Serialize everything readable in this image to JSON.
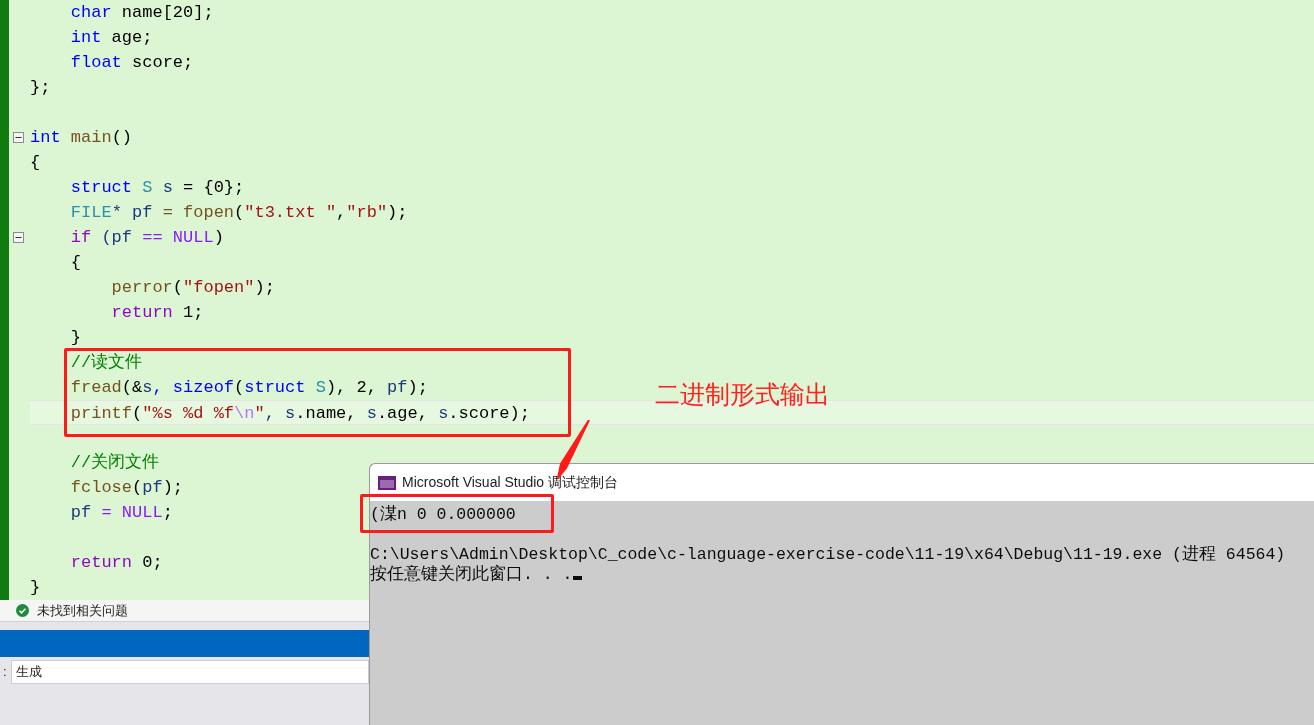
{
  "editor": {
    "lines": [
      {
        "fold_marker": false,
        "current": false,
        "tokens": [
          {
            "t": "    char",
            "kind": "keyword"
          },
          {
            "t": " name[20];",
            "kind": "plain"
          }
        ]
      },
      {
        "fold_marker": false,
        "current": false,
        "tokens": [
          {
            "t": "    int",
            "kind": "keyword"
          },
          {
            "t": " age;",
            "kind": "plain"
          }
        ]
      },
      {
        "fold_marker": false,
        "current": false,
        "tokens": [
          {
            "t": "    float",
            "kind": "keyword"
          },
          {
            "t": " score;",
            "kind": "plain"
          }
        ]
      },
      {
        "fold_marker": false,
        "current": false,
        "tokens": [
          {
            "t": "};",
            "kind": "plain"
          }
        ]
      },
      {
        "fold_marker": false,
        "current": false
      },
      {
        "fold_marker": true,
        "current": false,
        "tokens": [
          {
            "t": "int",
            "kind": "keyword"
          },
          {
            "t": " main",
            "kind": "function"
          },
          {
            "t": "()",
            "kind": "plain"
          }
        ]
      },
      {
        "fold_marker": false,
        "current": false,
        "tokens": [
          {
            "t": "{",
            "kind": "plain"
          }
        ]
      },
      {
        "fold_marker": false,
        "current": false,
        "tokens": [
          {
            "t": "    struct",
            "kind": "keyword"
          },
          {
            "t": " S",
            "kind": "type"
          },
          {
            "t": " s",
            "kind": "local"
          },
          {
            "t": " = {0};",
            "kind": "plain"
          }
        ]
      },
      {
        "fold_marker": false,
        "current": false,
        "tokens": [
          {
            "t": "    FILE",
            "kind": "type"
          },
          {
            "t": "* pf",
            "kind": "local"
          },
          {
            "t": " = fopen",
            "kind": "function"
          },
          {
            "t": "(",
            "kind": "plain"
          },
          {
            "t": "\"t3.txt \"",
            "kind": "string"
          },
          {
            "t": ",",
            "kind": "plain"
          },
          {
            "t": "\"rb\"",
            "kind": "string"
          },
          {
            "t": ");",
            "kind": "plain"
          }
        ]
      },
      {
        "fold_marker": true,
        "current": false,
        "tokens": [
          {
            "t": "    if",
            "kind": "control"
          },
          {
            "t": " (pf",
            "kind": "local"
          },
          {
            "t": " == NULL",
            "kind": "macro"
          },
          {
            "t": ")",
            "kind": "plain"
          }
        ]
      },
      {
        "fold_marker": false,
        "current": false,
        "tokens": [
          {
            "t": "    {",
            "kind": "plain"
          }
        ]
      },
      {
        "fold_marker": false,
        "current": false,
        "tokens": [
          {
            "t": "        perror",
            "kind": "function"
          },
          {
            "t": "(",
            "kind": "plain"
          },
          {
            "t": "\"fopen\"",
            "kind": "string"
          },
          {
            "t": ");",
            "kind": "plain"
          }
        ]
      },
      {
        "fold_marker": false,
        "current": false,
        "tokens": [
          {
            "t": "        return",
            "kind": "control"
          },
          {
            "t": " 1;",
            "kind": "plain"
          }
        ]
      },
      {
        "fold_marker": false,
        "current": false,
        "tokens": [
          {
            "t": "    }",
            "kind": "plain"
          }
        ]
      },
      {
        "fold_marker": false,
        "current": false,
        "tokens": [
          {
            "t": "    //读文件",
            "kind": "comment"
          }
        ]
      },
      {
        "fold_marker": false,
        "current": false,
        "tokens": [
          {
            "t": "    fread",
            "kind": "function"
          },
          {
            "t": "(&",
            "kind": "plain"
          },
          {
            "t": "s",
            "kind": "local"
          },
          {
            "t": ", sizeof",
            "kind": "keyword"
          },
          {
            "t": "(",
            "kind": "plain"
          },
          {
            "t": "struct",
            "kind": "keyword"
          },
          {
            "t": " S",
            "kind": "type"
          },
          {
            "t": "), 2, ",
            "kind": "plain"
          },
          {
            "t": "pf",
            "kind": "local"
          },
          {
            "t": ");",
            "kind": "plain"
          }
        ]
      },
      {
        "fold_marker": false,
        "current": true,
        "tokens": [
          {
            "t": "    printf",
            "kind": "function"
          },
          {
            "t": "(",
            "kind": "plain"
          },
          {
            "t": "\"%s %d %f",
            "kind": "string"
          },
          {
            "t": "\\n",
            "kind": "escape"
          },
          {
            "t": "\"",
            "kind": "string"
          },
          {
            "t": ", s",
            "kind": "local"
          },
          {
            "t": ".name, ",
            "kind": "plain"
          },
          {
            "t": "s",
            "kind": "local"
          },
          {
            "t": ".age, ",
            "kind": "plain"
          },
          {
            "t": "s",
            "kind": "local"
          },
          {
            "t": ".score);",
            "kind": "plain"
          }
        ]
      },
      {
        "fold_marker": false,
        "current": false
      },
      {
        "fold_marker": false,
        "current": false,
        "tokens": [
          {
            "t": "    //关闭文件",
            "kind": "comment"
          }
        ]
      },
      {
        "fold_marker": false,
        "current": false,
        "tokens": [
          {
            "t": "    fclose",
            "kind": "function"
          },
          {
            "t": "(",
            "kind": "plain"
          },
          {
            "t": "pf",
            "kind": "local"
          },
          {
            "t": ");",
            "kind": "plain"
          }
        ]
      },
      {
        "fold_marker": false,
        "current": false,
        "tokens": [
          {
            "t": "    pf",
            "kind": "local"
          },
          {
            "t": " = NULL",
            "kind": "macro"
          },
          {
            "t": ";",
            "kind": "plain"
          }
        ]
      },
      {
        "fold_marker": false,
        "current": false
      },
      {
        "fold_marker": false,
        "current": false,
        "tokens": [
          {
            "t": "    return",
            "kind": "control"
          },
          {
            "t": " 0;",
            "kind": "plain"
          }
        ]
      },
      {
        "fold_marker": false,
        "current": false,
        "tokens": [
          {
            "t": "}",
            "kind": "plain"
          }
        ]
      }
    ]
  },
  "issues_status": "未找到相关问题",
  "output_panel": {
    "label": ":",
    "source": "生成"
  },
  "annotation": {
    "text": "二进制形式输出"
  },
  "console": {
    "title": "Microsoft Visual Studio 调试控制台",
    "lines": [
      "(湈n 0 0.000000",
      "C:\\Users\\Admin\\Desktop\\C_code\\c-language-exercise-code\\11-19\\x64\\Debug\\11-19.exe (进程 64564)",
      "按任意键关闭此窗口. . ."
    ]
  }
}
